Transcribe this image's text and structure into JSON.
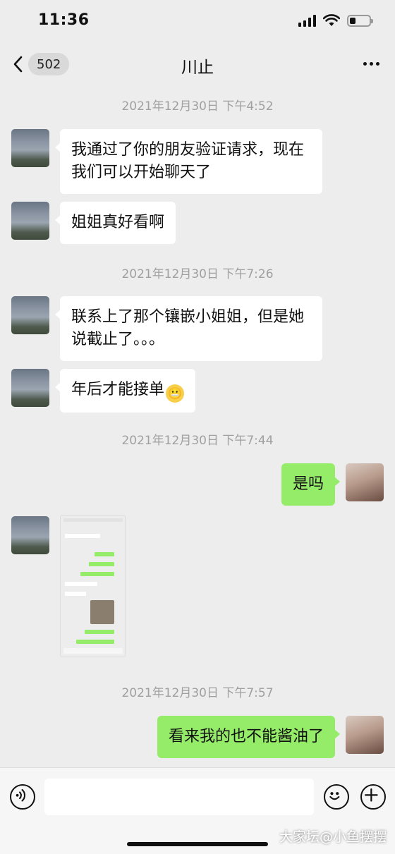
{
  "status_bar": {
    "time": "11:36",
    "battery_level": 0.3
  },
  "nav": {
    "back_count": "502",
    "title": "川止"
  },
  "timestamps": [
    "2021年12月30日 下午4:52",
    "2021年12月30日 下午7:26",
    "2021年12月30日 下午7:44",
    "2021年12月30日 下午7:57"
  ],
  "messages": [
    {
      "side": "in",
      "text_line1": "我通过了你的朋友验证请求，现在",
      "text_line2": "我们可以开始聊天了"
    },
    {
      "side": "in",
      "text": "姐姐真好看啊"
    },
    {
      "side": "in",
      "text_line1": "联系上了那个镶嵌小姐姐，但是她",
      "text_line2": "说截止了。。。"
    },
    {
      "side": "in",
      "text": "年后才能接单"
    },
    {
      "side": "out",
      "text": "是吗"
    },
    {
      "side": "in",
      "type": "image"
    },
    {
      "side": "out",
      "text": "看来我的也不能酱油了"
    }
  ],
  "input": {
    "placeholder": ""
  },
  "watermark": "大家坛@小鱼摆摆",
  "colors": {
    "background": "#ededed",
    "incoming_bubble": "#ffffff",
    "outgoing_bubble": "#95ec69"
  }
}
